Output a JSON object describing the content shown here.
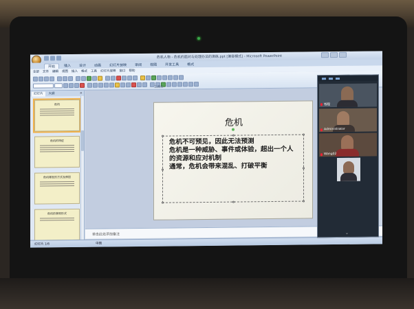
{
  "window": {
    "app_title": "危机人物 - 危机的面对与处理办法的演练.ppt [兼容模式] - Microsoft PowerPoint"
  },
  "ribbon_tabs": [
    "开始",
    "插入",
    "设计",
    "动画",
    "幻灯片放映",
    "审阅",
    "视图",
    "开发工具",
    "格式"
  ],
  "menus": [
    "全部",
    "文件",
    "编辑",
    "视图",
    "插入",
    "格式",
    "工具",
    "幻灯片放映",
    "窗口",
    "帮助"
  ],
  "toolbar_label": "工具栏",
  "outline_pane": {
    "tabs": [
      "幻灯片",
      "大纲"
    ],
    "close": "×",
    "thumbnails": [
      {
        "num": "",
        "title": "危机"
      },
      {
        "num": "",
        "title": "危机的特征"
      },
      {
        "num": "",
        "title": "危机爆发的方式及原因"
      },
      {
        "num": "",
        "title": "危机的表现形式"
      }
    ]
  },
  "slide": {
    "title": "危机",
    "bullets": [
      "危机不可预见，因此无法预测",
      "危机是一种威胁、事件或体验，超出一个人的资源和应对机制",
      "通常，危机会带来混乱、打破平衡"
    ]
  },
  "notes_placeholder": "单击此处添加备注",
  "status": {
    "left": "幻灯片 1/6",
    "theme": "中国"
  },
  "video": {
    "participants": [
      "钱程",
      "Administrator",
      "Wang02",
      ""
    ]
  },
  "colors": {
    "accent_orange": "#f1b24a",
    "ribbon_blue": "#c9d8ec",
    "mic_red": "#e23"
  }
}
